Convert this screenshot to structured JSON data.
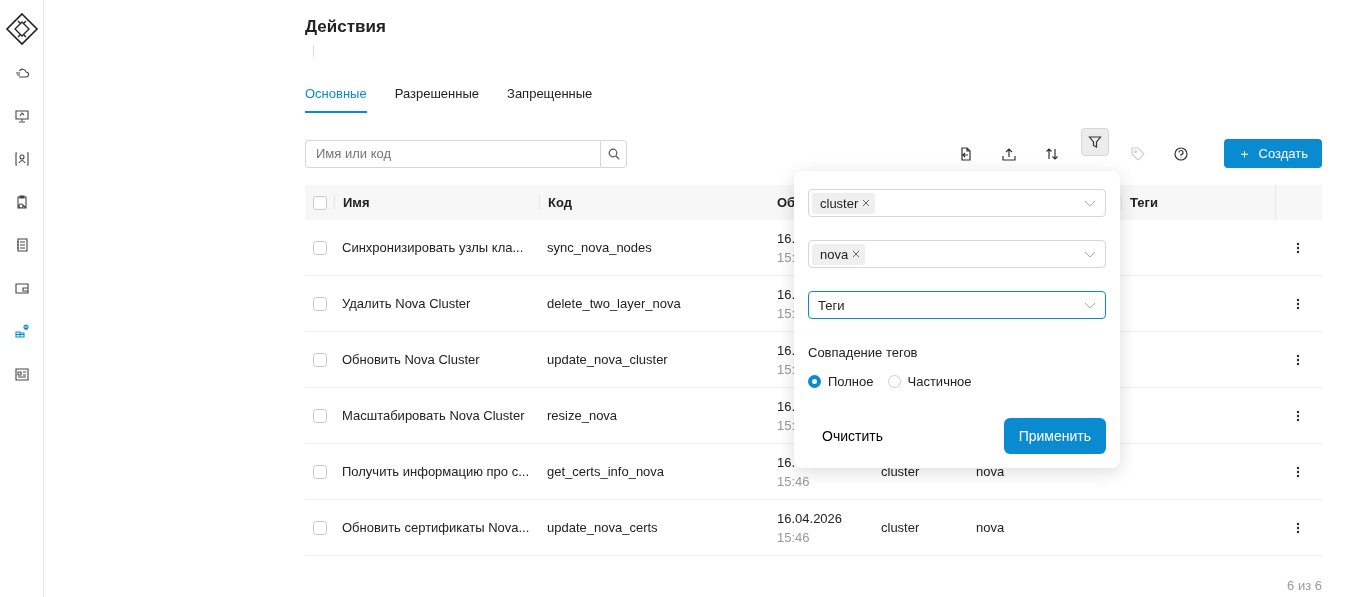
{
  "sidebar": {
    "items": [
      {
        "kind": "cloud",
        "selected": false
      },
      {
        "kind": "monitor",
        "selected": false
      },
      {
        "kind": "person",
        "selected": false
      },
      {
        "kind": "clipboard",
        "selected": false
      },
      {
        "kind": "list",
        "selected": false
      },
      {
        "kind": "wallet",
        "selected": false
      },
      {
        "kind": "flow",
        "selected": true
      },
      {
        "kind": "grid",
        "selected": false
      }
    ]
  },
  "page": {
    "title": "Действия"
  },
  "tabs": [
    {
      "label": "Основные",
      "selected": true
    },
    {
      "label": "Разрешенные",
      "selected": false
    },
    {
      "label": "Запрещенные",
      "selected": false
    }
  ],
  "search": {
    "placeholder": "Имя или код"
  },
  "toolbar": {
    "tools": [
      {
        "kind": "import",
        "selected": false,
        "disabled": false
      },
      {
        "kind": "upload",
        "selected": false,
        "disabled": false
      },
      {
        "kind": "sort",
        "selected": false,
        "disabled": false
      },
      {
        "kind": "filter",
        "selected": true,
        "disabled": false
      },
      {
        "kind": "tag",
        "selected": false,
        "disabled": true
      },
      {
        "kind": "help",
        "selected": false,
        "disabled": false
      }
    ],
    "create_icon": "＋",
    "create_label": "Создать"
  },
  "table": {
    "all_checked": false,
    "columns": [
      "Имя",
      "Код",
      "Об",
      "Теги"
    ],
    "rows": [
      {
        "checked": false,
        "name": "Синхронизировать узлы кла...",
        "code": "sync_nova_nodes",
        "date": "16.",
        "time": "15:"
      },
      {
        "checked": false,
        "name": "Удалить Nova Cluster",
        "code": "delete_two_layer_nova",
        "date": "16.",
        "time": "15:"
      },
      {
        "checked": false,
        "name": "Обновить Nova Cluster",
        "code": "update_nova_cluster",
        "date": "16.",
        "time": "15:"
      },
      {
        "checked": false,
        "name": "Масштабировать Nova Cluster",
        "code": "resize_nova",
        "date": "16.",
        "time": "15:"
      },
      {
        "checked": false,
        "name": "Получить информацию про с...",
        "code": "get_certs_info_nova",
        "date": "16.",
        "time": "15:46",
        "column_4": "cluster",
        "column_5": "nova"
      },
      {
        "checked": false,
        "name": "Обновить сертификаты Nova...",
        "code": "update_nova_certs",
        "date": "16.04.2026",
        "time": "15:46",
        "column_4": "cluster",
        "column_5": "nova"
      }
    ],
    "count": "6 из 6"
  },
  "filter_popover": {
    "selects": [
      {
        "chips": [
          "cluster"
        ]
      },
      {
        "chips": [
          "nova"
        ]
      },
      {
        "placeholder": "Теги",
        "focused": true
      }
    ],
    "match_label": "Совпадение тегов",
    "match_options": [
      {
        "label": "Полное",
        "selected": true
      },
      {
        "label": "Частичное",
        "selected": false
      }
    ],
    "clear_label": "Очистить",
    "apply_label": "Применить"
  }
}
